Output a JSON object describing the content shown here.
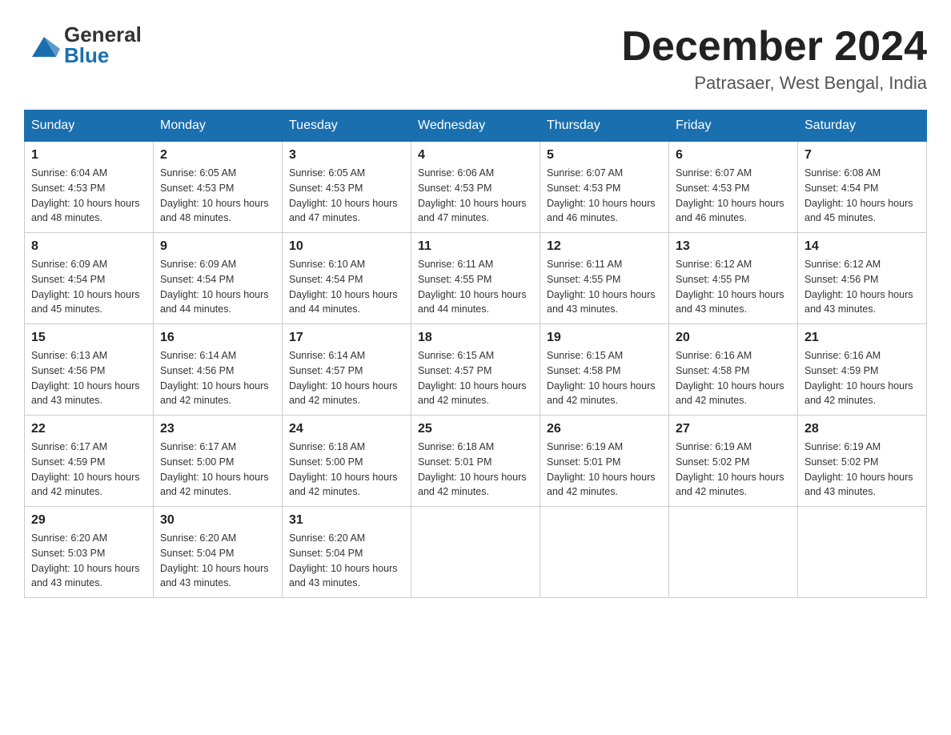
{
  "header": {
    "logo_general": "General",
    "logo_blue": "Blue",
    "month_year": "December 2024",
    "location": "Patrasaer, West Bengal, India"
  },
  "days_of_week": [
    "Sunday",
    "Monday",
    "Tuesday",
    "Wednesday",
    "Thursday",
    "Friday",
    "Saturday"
  ],
  "weeks": [
    [
      {
        "day": "1",
        "sunrise": "6:04 AM",
        "sunset": "4:53 PM",
        "daylight": "10 hours and 48 minutes."
      },
      {
        "day": "2",
        "sunrise": "6:05 AM",
        "sunset": "4:53 PM",
        "daylight": "10 hours and 48 minutes."
      },
      {
        "day": "3",
        "sunrise": "6:05 AM",
        "sunset": "4:53 PM",
        "daylight": "10 hours and 47 minutes."
      },
      {
        "day": "4",
        "sunrise": "6:06 AM",
        "sunset": "4:53 PM",
        "daylight": "10 hours and 47 minutes."
      },
      {
        "day": "5",
        "sunrise": "6:07 AM",
        "sunset": "4:53 PM",
        "daylight": "10 hours and 46 minutes."
      },
      {
        "day": "6",
        "sunrise": "6:07 AM",
        "sunset": "4:53 PM",
        "daylight": "10 hours and 46 minutes."
      },
      {
        "day": "7",
        "sunrise": "6:08 AM",
        "sunset": "4:54 PM",
        "daylight": "10 hours and 45 minutes."
      }
    ],
    [
      {
        "day": "8",
        "sunrise": "6:09 AM",
        "sunset": "4:54 PM",
        "daylight": "10 hours and 45 minutes."
      },
      {
        "day": "9",
        "sunrise": "6:09 AM",
        "sunset": "4:54 PM",
        "daylight": "10 hours and 44 minutes."
      },
      {
        "day": "10",
        "sunrise": "6:10 AM",
        "sunset": "4:54 PM",
        "daylight": "10 hours and 44 minutes."
      },
      {
        "day": "11",
        "sunrise": "6:11 AM",
        "sunset": "4:55 PM",
        "daylight": "10 hours and 44 minutes."
      },
      {
        "day": "12",
        "sunrise": "6:11 AM",
        "sunset": "4:55 PM",
        "daylight": "10 hours and 43 minutes."
      },
      {
        "day": "13",
        "sunrise": "6:12 AM",
        "sunset": "4:55 PM",
        "daylight": "10 hours and 43 minutes."
      },
      {
        "day": "14",
        "sunrise": "6:12 AM",
        "sunset": "4:56 PM",
        "daylight": "10 hours and 43 minutes."
      }
    ],
    [
      {
        "day": "15",
        "sunrise": "6:13 AM",
        "sunset": "4:56 PM",
        "daylight": "10 hours and 43 minutes."
      },
      {
        "day": "16",
        "sunrise": "6:14 AM",
        "sunset": "4:56 PM",
        "daylight": "10 hours and 42 minutes."
      },
      {
        "day": "17",
        "sunrise": "6:14 AM",
        "sunset": "4:57 PM",
        "daylight": "10 hours and 42 minutes."
      },
      {
        "day": "18",
        "sunrise": "6:15 AM",
        "sunset": "4:57 PM",
        "daylight": "10 hours and 42 minutes."
      },
      {
        "day": "19",
        "sunrise": "6:15 AM",
        "sunset": "4:58 PM",
        "daylight": "10 hours and 42 minutes."
      },
      {
        "day": "20",
        "sunrise": "6:16 AM",
        "sunset": "4:58 PM",
        "daylight": "10 hours and 42 minutes."
      },
      {
        "day": "21",
        "sunrise": "6:16 AM",
        "sunset": "4:59 PM",
        "daylight": "10 hours and 42 minutes."
      }
    ],
    [
      {
        "day": "22",
        "sunrise": "6:17 AM",
        "sunset": "4:59 PM",
        "daylight": "10 hours and 42 minutes."
      },
      {
        "day": "23",
        "sunrise": "6:17 AM",
        "sunset": "5:00 PM",
        "daylight": "10 hours and 42 minutes."
      },
      {
        "day": "24",
        "sunrise": "6:18 AM",
        "sunset": "5:00 PM",
        "daylight": "10 hours and 42 minutes."
      },
      {
        "day": "25",
        "sunrise": "6:18 AM",
        "sunset": "5:01 PM",
        "daylight": "10 hours and 42 minutes."
      },
      {
        "day": "26",
        "sunrise": "6:19 AM",
        "sunset": "5:01 PM",
        "daylight": "10 hours and 42 minutes."
      },
      {
        "day": "27",
        "sunrise": "6:19 AM",
        "sunset": "5:02 PM",
        "daylight": "10 hours and 42 minutes."
      },
      {
        "day": "28",
        "sunrise": "6:19 AM",
        "sunset": "5:02 PM",
        "daylight": "10 hours and 43 minutes."
      }
    ],
    [
      {
        "day": "29",
        "sunrise": "6:20 AM",
        "sunset": "5:03 PM",
        "daylight": "10 hours and 43 minutes."
      },
      {
        "day": "30",
        "sunrise": "6:20 AM",
        "sunset": "5:04 PM",
        "daylight": "10 hours and 43 minutes."
      },
      {
        "day": "31",
        "sunrise": "6:20 AM",
        "sunset": "5:04 PM",
        "daylight": "10 hours and 43 minutes."
      },
      null,
      null,
      null,
      null
    ]
  ],
  "labels": {
    "sunrise": "Sunrise:",
    "sunset": "Sunset:",
    "daylight": "Daylight:"
  }
}
